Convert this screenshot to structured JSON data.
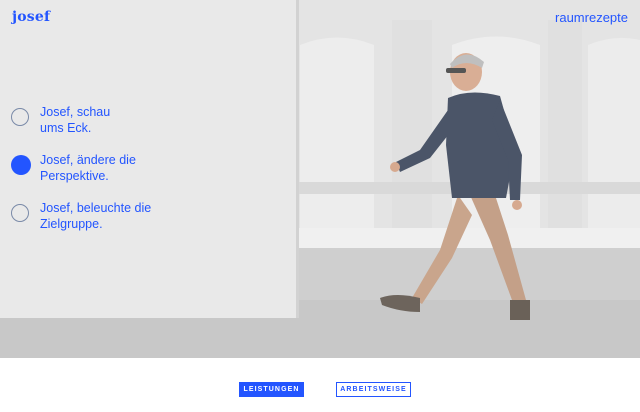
{
  "header": {
    "logo": "josef",
    "brand_link": "raumrezepte"
  },
  "options": [
    {
      "label": "Josef, schau\nums Eck.",
      "selected": false
    },
    {
      "label": "Josef, ändere die\nPerspektive.",
      "selected": true
    },
    {
      "label": "Josef, beleuchte die\nZielgruppe.",
      "selected": false
    }
  ],
  "footer": {
    "primary_button": "LEISTUNGEN",
    "secondary_button": "ARBEITSWEISE"
  },
  "colors": {
    "accent": "#2355ff",
    "background": "#ffffff"
  }
}
